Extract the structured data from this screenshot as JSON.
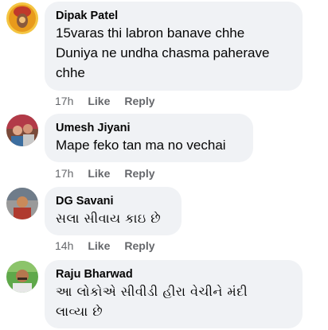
{
  "comments": [
    {
      "author": "Dipak Patel",
      "lines": [
        "15varas thi labron banave chhe",
        "Duniya ne undha chasma paherave",
        "chhe"
      ],
      "time": "17h",
      "like": "Like",
      "reply": "Reply"
    },
    {
      "author": "Umesh Jiyani",
      "lines": [
        "Mape feko tan ma no vechai"
      ],
      "time": "17h",
      "like": "Like",
      "reply": "Reply"
    },
    {
      "author": "DG Savani",
      "lines": [
        "સલા સીવાય કાઇ છે"
      ],
      "time": "14h",
      "like": "Like",
      "reply": "Reply"
    },
    {
      "author": "Raju Bharwad",
      "lines": [
        "આ લોકોએ સીવીડી હીરા વેચીને મંદી",
        "લાવ્યા છે"
      ],
      "time": "",
      "like": "",
      "reply": ""
    }
  ],
  "colors": {
    "bubble": "#f0f2f5",
    "meta": "#65676b",
    "text": "#050505"
  }
}
